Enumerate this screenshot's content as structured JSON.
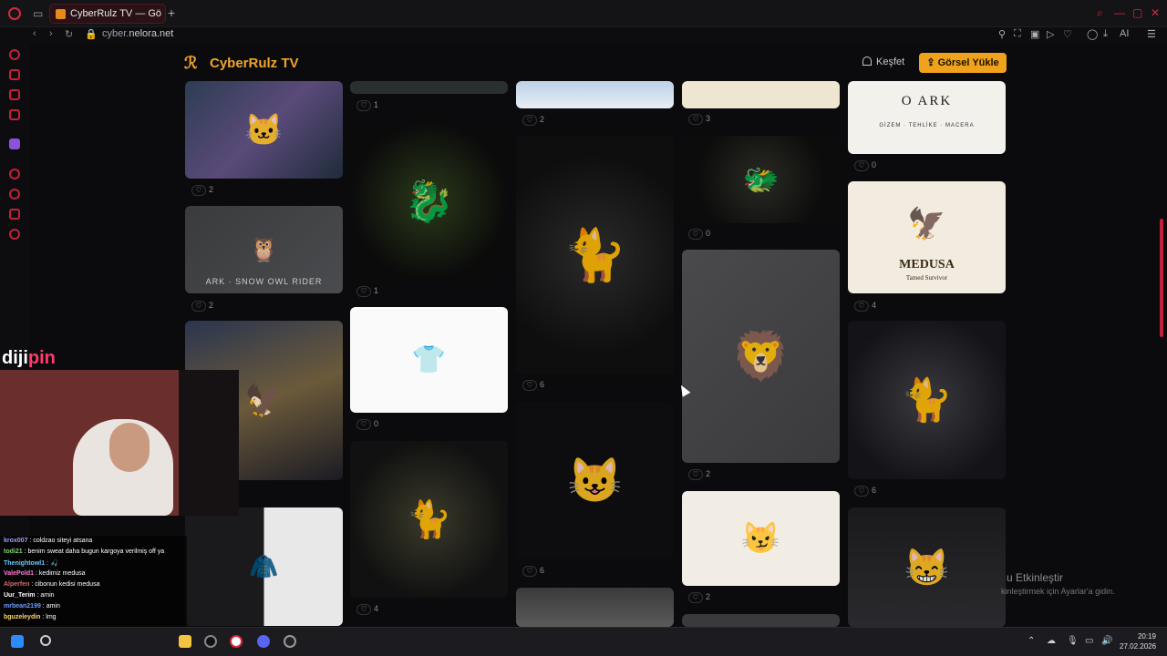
{
  "browser": {
    "tab_title": "CyberRulz TV — Görsel Paylaşım",
    "url_prefix": "cyber.",
    "url_domain": "nelora.net",
    "toolbar_ai": "AI"
  },
  "site": {
    "logo_text": "CyberRulz TV",
    "explore_label": "Keşfet",
    "upload_label": "Görsel Yükle",
    "accent_color": "#f0a21d"
  },
  "gallery": {
    "cards": [
      {
        "id": "c1",
        "likes": "2",
        "caption": ""
      },
      {
        "id": "c2",
        "likes": "2",
        "caption": "ARK · SNOW OWL RIDER"
      },
      {
        "id": "c3",
        "likes": "",
        "caption": ""
      },
      {
        "id": "c4",
        "likes": "1",
        "caption": ""
      },
      {
        "id": "c5",
        "likes": "1",
        "caption": ""
      },
      {
        "id": "c6",
        "likes": "0",
        "caption": ""
      },
      {
        "id": "c7",
        "likes": "4",
        "caption": ""
      },
      {
        "id": "c8",
        "likes": "2",
        "caption": ""
      },
      {
        "id": "c9",
        "likes": "6",
        "caption": ""
      },
      {
        "id": "c10",
        "likes": "6",
        "caption": ""
      },
      {
        "id": "c11",
        "likes": "3",
        "caption": ""
      },
      {
        "id": "c12",
        "likes": "0",
        "caption": ""
      },
      {
        "id": "c13",
        "likes": "2",
        "caption": ""
      },
      {
        "id": "c14",
        "likes": "2",
        "caption": ""
      },
      {
        "id": "c15",
        "likes": "0",
        "caption": "GİZEM · TEHLİKE · MACERA"
      },
      {
        "id": "c16",
        "likes": "4",
        "caption": "MEDUSA"
      },
      {
        "id": "c17",
        "likes": "6",
        "caption": ""
      }
    ],
    "ark_title": "O ARK",
    "medusa_sub": "Tamed Survivor"
  },
  "stream": {
    "brand_a": "diji",
    "brand_b": "pin",
    "chat": [
      {
        "user": "krox007",
        "msg": "coldzao siteyi atsana",
        "color": "#a0a0ff"
      },
      {
        "user": "todi21",
        "msg": "benim sweat daha bugun kargoya verilmiş off ya",
        "color": "#7bd36b"
      },
      {
        "user": "Thenightowl1",
        "msg": "🎣",
        "color": "#6bc8ff"
      },
      {
        "user": "ValePold1",
        "msg": "kedimiz medusa",
        "color": "#ff7bd1"
      },
      {
        "user": "Alperfen",
        "msg": "cibonun kedisi medusa",
        "color": "#d46b6b"
      },
      {
        "user": "Uur_Terim",
        "msg": "amin",
        "color": "#ffffff"
      },
      {
        "user": "mrbean2199",
        "msg": "amin",
        "color": "#6b9bff"
      },
      {
        "user": "bguzeleydin",
        "msg": "lmg",
        "color": "#ffd36b"
      }
    ]
  },
  "notice": {
    "title": "u Etkinleştir",
    "body": "kinleştirmek için Ayarlar'a gidin."
  },
  "clock": {
    "time": "20:19",
    "date": "27.02.2026"
  }
}
